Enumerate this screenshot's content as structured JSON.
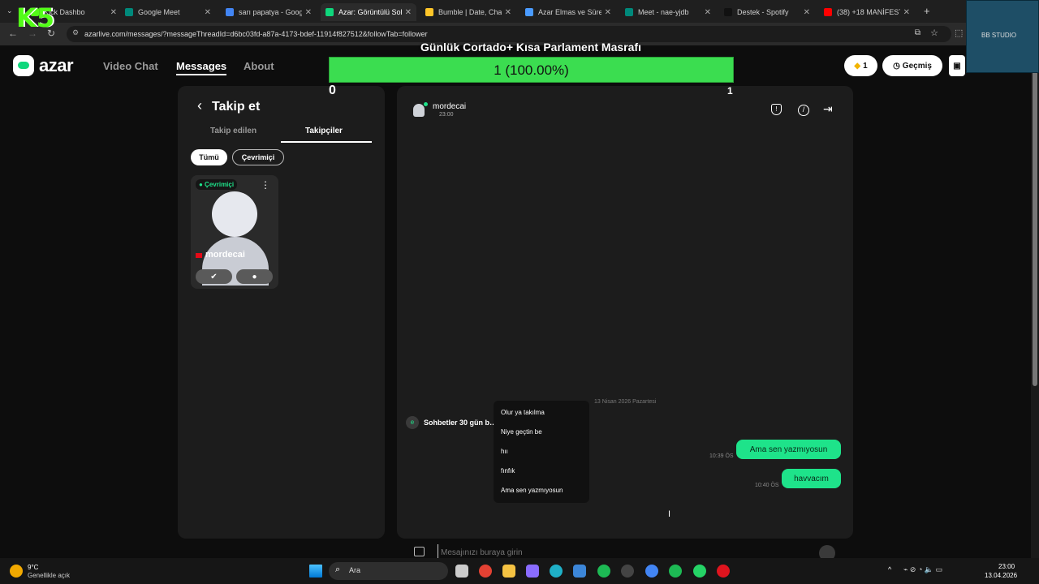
{
  "browser": {
    "tabs": [
      {
        "title": "Kick Dashbo",
        "color": "#53fc18"
      },
      {
        "title": "Google Meet",
        "color": "#00897b"
      },
      {
        "title": "sarı papatya - Google",
        "color": "#4285f4"
      },
      {
        "title": "Azar: Görüntülü Sohb",
        "color": "#0fd77c",
        "active": true
      },
      {
        "title": "Bumble | Date, Chat,",
        "color": "#ffc629"
      },
      {
        "title": "Azar Elmas ve Süre H",
        "color": "#4a9bff"
      },
      {
        "title": "Meet - nae-yjdb",
        "color": "#00897b"
      },
      {
        "title": "Destek - Spotify",
        "color": "#111111"
      },
      {
        "title": "(38) +18 MANİFEST",
        "color": "#ff0000"
      }
    ],
    "tab_close": "✕",
    "new_tab": "+",
    "url": "azarlive.com/messages/?messageThreadId=d6bc03fd-a87a-4173-bdef-11914f827512&followTab=follower"
  },
  "overlay": {
    "kick_logo": "K5",
    "title": "Günlük Cortado+ Kısa Parlament Masrafı",
    "progress_label": "1 (100.00%)",
    "progress_fraction": 1.0,
    "min": "0",
    "max": "1",
    "studio": "BB STUDIO"
  },
  "header": {
    "brand": "azar",
    "nav": [
      "Video Chat",
      "Messages",
      "About"
    ],
    "gems": "1",
    "history": "Geçmiş"
  },
  "left_panel": {
    "back": "‹",
    "title": "Takip et",
    "tabs": [
      "Takip edilen",
      "Takipçiler"
    ],
    "filters": [
      "Tümü",
      "Çevrimiçi"
    ],
    "card": {
      "status": "● Çevrimiçi",
      "name": "mordecai",
      "menu": "⋮",
      "flag": "🇹🇷"
    }
  },
  "chat": {
    "user": "mordecai",
    "user_sub": "23:00",
    "date_label": "13 Nisan 2026 Pazartesi",
    "notice": "Sohbetler 30 gün b… esajlara erişilemeyebilir.",
    "messages": [
      {
        "text": "Ama sen yazmıyosun",
        "time": "10:39 ÖS"
      },
      {
        "text": "havvacım",
        "time": "10:40 ÖS"
      }
    ],
    "placeholder": "Mesajınızı buraya girin",
    "suggestions": [
      "Olur ya takılma",
      "Niye geçtin be",
      "hıı",
      "fınfık",
      "Ama sen yazmıyosun"
    ]
  },
  "taskbar": {
    "weather_temp": "9°C",
    "weather_desc": "Genellikle açık",
    "search": "Ara",
    "time": "23:00",
    "date": "13.04.2026"
  }
}
